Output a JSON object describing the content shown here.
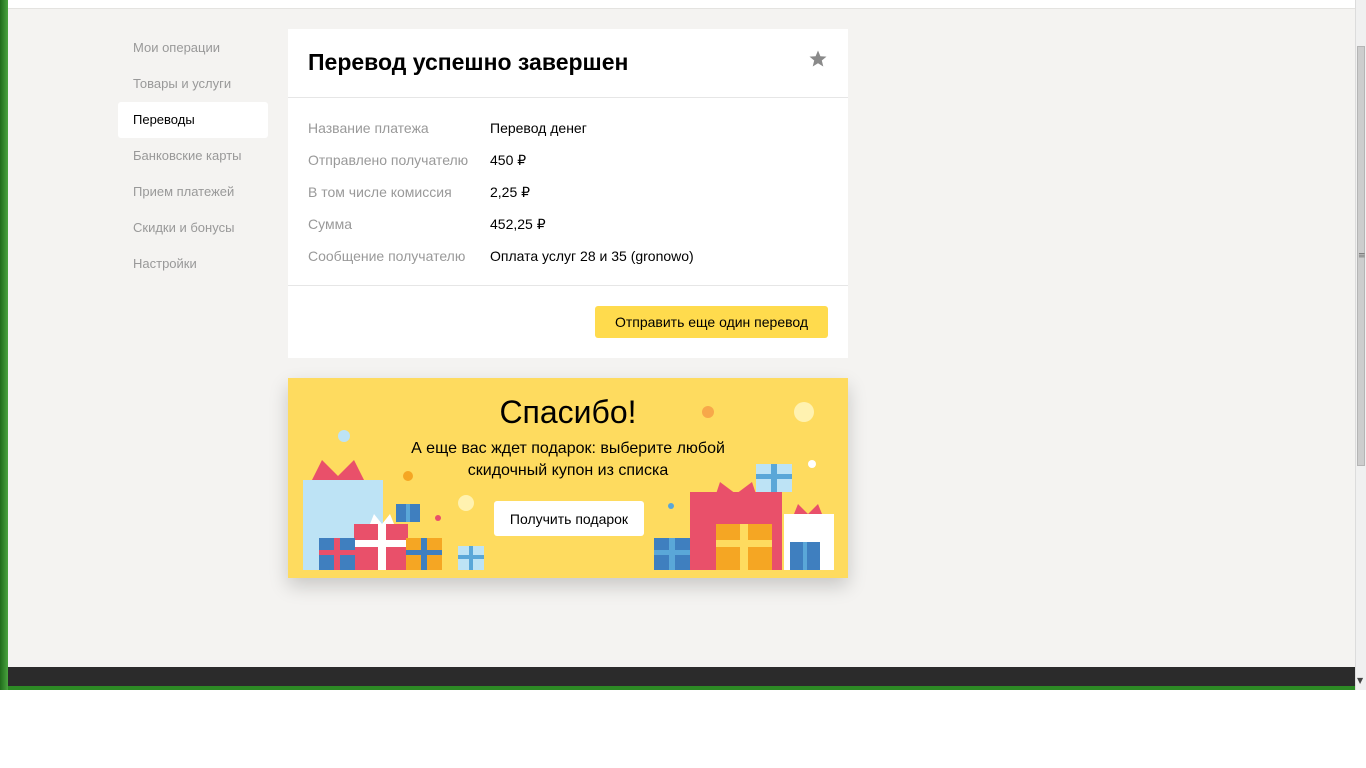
{
  "sidebar": {
    "items": [
      {
        "label": "Мои операции"
      },
      {
        "label": "Товары и услуги"
      },
      {
        "label": "Переводы"
      },
      {
        "label": "Банковские карты"
      },
      {
        "label": "Прием платежей"
      },
      {
        "label": "Скидки и бонусы"
      },
      {
        "label": "Настройки"
      }
    ],
    "active": "Переводы"
  },
  "card": {
    "title": "Перевод успешно завершен",
    "details": [
      {
        "label": "Название платежа",
        "value": "Перевод денег"
      },
      {
        "label": "Отправлено получателю",
        "value": "450 ₽"
      },
      {
        "label": "В том числе комиссия",
        "value": "2,25 ₽"
      },
      {
        "label": "Сумма",
        "value": "452,25 ₽"
      },
      {
        "label": "Сообщение получателю",
        "value": "Оплата услуг 28 и 35 (gronowo)"
      }
    ],
    "send_again_label": "Отправить еще один перевод",
    "favorite_icon": "star-icon"
  },
  "promo": {
    "title": "Спасибо!",
    "subtitle": "А еще вас ждет подарок: выберите любой скидочный купон из списка",
    "button_label": "Получить подарок"
  },
  "colors": {
    "accent": "#ffdb4d",
    "promo_bg": "#fedb5f",
    "page_bg": "#f4f3f1",
    "muted_text": "#999999"
  }
}
